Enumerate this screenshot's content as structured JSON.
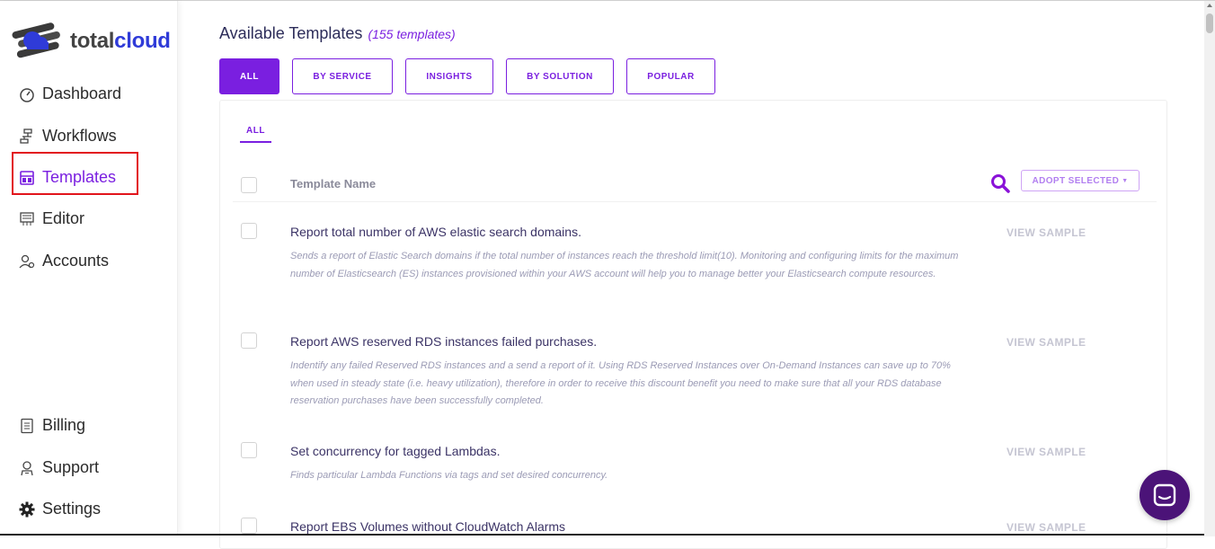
{
  "app": {
    "logo_part1": "total",
    "logo_part2": "cloud"
  },
  "sidebar": {
    "top_items": [
      {
        "label": "Dashboard",
        "icon": "gauge-icon"
      },
      {
        "label": "Workflows",
        "icon": "workflow-icon"
      },
      {
        "label": "Templates",
        "icon": "template-icon",
        "active": true
      },
      {
        "label": "Editor",
        "icon": "editor-icon"
      },
      {
        "label": "Accounts",
        "icon": "accounts-icon"
      }
    ],
    "bottom_items": [
      {
        "label": "Billing",
        "icon": "billing-icon"
      },
      {
        "label": "Support",
        "icon": "support-icon"
      },
      {
        "label": "Settings",
        "icon": "gear-icon"
      }
    ]
  },
  "main": {
    "title": "Available Templates",
    "count": "(155 templates)",
    "filters": [
      "ALL",
      "BY SERVICE",
      "INSIGHTS",
      "BY SOLUTION",
      "POPULAR"
    ],
    "subtab": "ALL",
    "table": {
      "header": "Template Name",
      "adopt_label": "ADOPT SELECTED",
      "view_label": "VIEW SAMPLE",
      "rows": [
        {
          "title": "Report total number of AWS elastic search domains.",
          "description": "Sends a report of Elastic Search domains if the total number of instances reach the threshold limit(10). Monitoring and configuring limits for the maximum number of Elasticsearch (ES) instances provisioned within your AWS account will help you to manage better your Elasticsearch compute resources."
        },
        {
          "title": "Report AWS reserved RDS instances failed purchases.",
          "description": "Indentify any failed Reserved RDS instances and a send a report of it. Using RDS Reserved Instances over On-Demand Instances can save up to 70% when used in steady state (i.e. heavy utilization), therefore in order to receive this discount benefit you need to make sure that all your RDS database reservation purchases have been successfully completed."
        },
        {
          "title": "Set concurrency for tagged Lambdas.",
          "description": "Finds particular Lambda Functions via tags and set desired concurrency."
        },
        {
          "title": "Report EBS Volumes without CloudWatch Alarms",
          "description": ""
        }
      ]
    }
  },
  "colors": {
    "accent": "#7a1fe0",
    "highlight_box": "#e2141c",
    "chat": "#4b1378"
  }
}
